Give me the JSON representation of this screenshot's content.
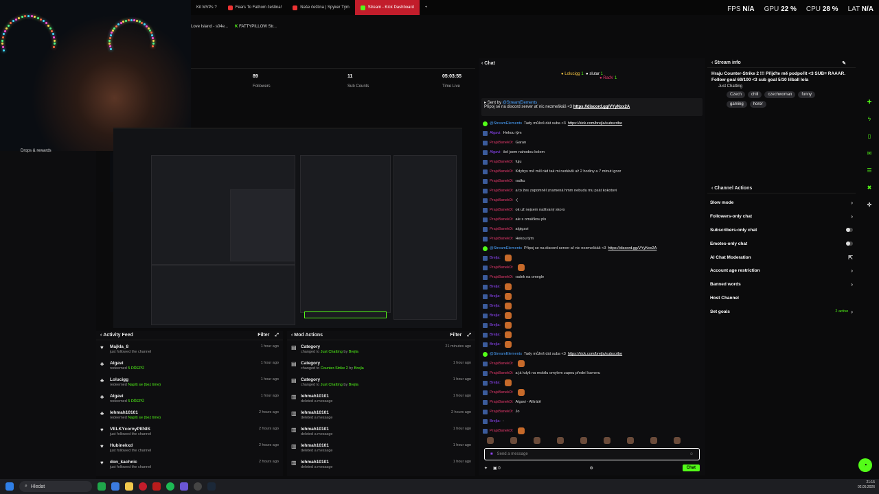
{
  "browser": {
    "tabs": [
      {
        "label": "Kit MVPs ?",
        "active": false
      },
      {
        "label": "Fears To Fathom čeština!",
        "active": false
      },
      {
        "label": "Naše čeština | Spyker Tým",
        "active": false
      },
      {
        "label": "Stream - Kick Dashboard",
        "active": true
      }
    ],
    "new_tab": "+",
    "bookmarks": [
      "Love Island - s04e...",
      "FATTYPILLOW Str..."
    ]
  },
  "perf": {
    "fps_label": "FPS",
    "fps": "N/A",
    "gpu_label": "GPU",
    "gpu": "22 %",
    "cpu_label": "CPU",
    "cpu": "28 %",
    "lat_label": "LAT",
    "lat": "N/A"
  },
  "left": {
    "drops": "Drops & rewards"
  },
  "stats": [
    {
      "value": "89",
      "label": "Followers"
    },
    {
      "value": "11",
      "label": "Sub Counts"
    },
    {
      "value": "05:03:55",
      "label": "Time Live"
    }
  ],
  "activity": {
    "title": "Activity Feed",
    "filter": "Filter",
    "items": [
      {
        "icon": "heart-icon",
        "user": "Majkla_8",
        "action": "just followed the channel",
        "highlight": "",
        "time": "1 hour ago"
      },
      {
        "icon": "reward-icon",
        "user": "Algavi",
        "action": "redeemed",
        "highlight": "5 DŘEPŮ",
        "time": "1 hour ago"
      },
      {
        "icon": "reward-icon",
        "user": "Lolucigg",
        "action": "redeemed",
        "highlight": "Napíš se (bez time)",
        "time": "1 hour ago"
      },
      {
        "icon": "reward-icon",
        "user": "Algavi",
        "action": "redeemed",
        "highlight": "5 DŘEPŮ",
        "time": "1 hour ago"
      },
      {
        "icon": "reward-icon",
        "user": "lehmah10101",
        "action": "redeemed",
        "highlight": "Napíš se (bez time)",
        "time": "2 hours ago"
      },
      {
        "icon": "heart-icon",
        "user": "VELKYcornyPENIS",
        "action": "just followed the channel",
        "highlight": "",
        "time": "2 hours ago"
      },
      {
        "icon": "heart-icon",
        "user": "Hubinekxd",
        "action": "just followed the channel",
        "highlight": "",
        "time": "2 hours ago"
      },
      {
        "icon": "heart-icon",
        "user": "don_kachnic",
        "action": "just followed the channel",
        "highlight": "",
        "time": "2 hours ago"
      }
    ]
  },
  "mod": {
    "title": "Mod Actions",
    "filter": "Filter",
    "items": [
      {
        "icon": "category-icon",
        "user": "Category",
        "action": "changed to",
        "highlight": "Just Chatting",
        "by": "by",
        "by_user": "Brejla",
        "time": "21 minutes ago"
      },
      {
        "icon": "category-icon",
        "user": "Category",
        "action": "changed to",
        "highlight": "Counter-Strike 2",
        "by": "by",
        "by_user": "Brejla",
        "time": "1 hour ago"
      },
      {
        "icon": "category-icon",
        "user": "Category",
        "action": "changed to",
        "highlight": "Just Chatting",
        "by": "by",
        "by_user": "Brejla",
        "time": "1 hour ago"
      },
      {
        "icon": "delete-icon",
        "user": "lehmah10101",
        "action": "deleted a message",
        "highlight": "",
        "by": "",
        "by_user": "",
        "time": "1 hour ago"
      },
      {
        "icon": "delete-icon",
        "user": "lehmah10101",
        "action": "deleted a message",
        "highlight": "",
        "by": "",
        "by_user": "",
        "time": "2 hours ago"
      },
      {
        "icon": "delete-icon",
        "user": "lehmah10101",
        "action": "deleted a message",
        "highlight": "",
        "by": "",
        "by_user": "",
        "time": "1 hour ago"
      },
      {
        "icon": "delete-icon",
        "user": "lehmah10101",
        "action": "deleted a message",
        "highlight": "",
        "by": "",
        "by_user": "",
        "time": "1 hour ago"
      },
      {
        "icon": "delete-icon",
        "user": "lehmah10101",
        "action": "deleted a message",
        "highlight": "",
        "by": "",
        "by_user": "",
        "time": "1 hour ago"
      }
    ]
  },
  "chat": {
    "title": "Chat",
    "viewers": [
      {
        "name": "Lolucigg",
        "n": "1"
      },
      {
        "name": "slutar",
        "n": "1"
      },
      {
        "name": "RadV",
        "n": "1"
      }
    ],
    "pinned": {
      "by": "Sent by",
      "author": "@StreamElements",
      "text": "Připoj se na discord server ať nic nezmeškáš <3",
      "link": "https://discord.gg/VYyNxx2A"
    },
    "messages": [
      {
        "user": "@StreamElements",
        "text": "Tady můžeš dát suba <3",
        "link": "https://kick.com/brejla/subscribe",
        "cls": "n3"
      },
      {
        "user": "Algavi:",
        "text": "Hekou tým",
        "link": "",
        "cls": "n2"
      },
      {
        "user": "PrajsBanek0l:",
        "text": "Garan",
        "link": "",
        "cls": "n"
      },
      {
        "user": "Algavi:",
        "text": "šel jsem nahodou kolem",
        "link": "",
        "cls": "n2"
      },
      {
        "user": "PrajsBanek0l:",
        "text": "fuju",
        "link": "",
        "cls": "n"
      },
      {
        "user": "PrajsBanek0l:",
        "text": "Kdybys mě měl rád tak mi nedávši už 2 hodiny a 7 minut ignor",
        "link": "",
        "cls": "n"
      },
      {
        "user": "PrajsBanek0l:",
        "text": "radku",
        "link": "",
        "cls": "n"
      },
      {
        "user": "PrajsBanek0l:",
        "text": "a to žes zapomněl znamená hmm nebudu mu psát kokotovi",
        "link": "",
        "cls": "n"
      },
      {
        "user": "PrajsBanek0l:",
        "text": ":(",
        "link": "",
        "cls": "n"
      },
      {
        "user": "PrajsBanek0l:",
        "text": "ok už nejsem naštvaný skoro",
        "link": "",
        "cls": "n"
      },
      {
        "user": "PrajsBanek0l:",
        "text": "ale s omáčkou pls",
        "link": "",
        "cls": "n"
      },
      {
        "user": "PrajsBanek0l:",
        "text": "algigavi",
        "link": "",
        "cls": "n"
      },
      {
        "user": "PrajsBanek0l:",
        "text": "Hekou tým",
        "link": "",
        "cls": "n"
      },
      {
        "user": "@StreamElements",
        "text": "Připoj se na discord server ať nic nezmeškáš <3",
        "link": "https://discord.gg/VYyNxx2A",
        "cls": "n3"
      },
      {
        "user": "Brejla:",
        "text": "",
        "link": "",
        "cls": "n2"
      },
      {
        "user": "PrajsBanek0l:",
        "text": "",
        "link": "",
        "cls": "n"
      },
      {
        "user": "PrajsBanek0l:",
        "text": "radek na omegle",
        "link": "",
        "cls": "n"
      },
      {
        "user": "Brejla:",
        "text": "",
        "link": "",
        "cls": "n2"
      },
      {
        "user": "Brejla:",
        "text": "",
        "link": "",
        "cls": "n2"
      },
      {
        "user": "Brejla:",
        "text": "",
        "link": "",
        "cls": "n2"
      },
      {
        "user": "Brejla:",
        "text": "",
        "link": "",
        "cls": "n2"
      },
      {
        "user": "Brejla:",
        "text": "",
        "link": "",
        "cls": "n2"
      },
      {
        "user": "Brejla:",
        "text": "",
        "link": "",
        "cls": "n2"
      },
      {
        "user": "Brejla:",
        "text": "",
        "link": "",
        "cls": "n2"
      },
      {
        "user": "@StreamElements",
        "text": "Tady můžeš dát suba <3",
        "link": "https://kick.com/brejla/subscribe",
        "cls": "n3"
      },
      {
        "user": "PrajsBanek0l:",
        "text": "",
        "link": "",
        "cls": "n"
      },
      {
        "user": "PrajsBanek0l:",
        "text": "a já když na mobilu omylem zapnu přední kameru",
        "link": "",
        "cls": "n"
      },
      {
        "user": "Brejla:",
        "text": "",
        "link": "",
        "cls": "n2"
      },
      {
        "user": "PrajsBanek0l:",
        "text": "",
        "link": "",
        "cls": "n"
      },
      {
        "user": "PrajsBanek0l:",
        "text": "Algavi - Alltrátě",
        "link": "",
        "cls": "n"
      },
      {
        "user": "PrajsBanek0l:",
        "text": "Jo",
        "link": "",
        "cls": "n"
      },
      {
        "user": "Brejla:",
        "text": "-",
        "link": "",
        "cls": "n2"
      },
      {
        "user": "PrajsBanek0l:",
        "text": "",
        "link": "",
        "cls": "n"
      }
    ],
    "placeholder": "Send a message",
    "counter": "0",
    "chat_button": "Chat"
  },
  "stream_info": {
    "title": "Stream info",
    "text": "Hraju Counter-Strike 2 !!! Přijďte mě podpořit <3 SUB= RAAAR. Follow goal 69/100 <3 sub goal 5/10 lilball lola",
    "category": "Just Chatting",
    "tags": [
      "Czech",
      "chill",
      "czechwoman",
      "funny",
      "gaming",
      "horor"
    ]
  },
  "channel_actions": {
    "title": "Channel Actions",
    "items": [
      {
        "label": "Slow mode",
        "control": "chevron"
      },
      {
        "label": "Followers-only chat",
        "control": "chevron"
      },
      {
        "label": "Subscribers-only chat",
        "control": "toggle"
      },
      {
        "label": "Emotes-only chat",
        "control": "toggle"
      },
      {
        "label": "AI Chat Moderation",
        "control": "external"
      },
      {
        "label": "Account age restriction",
        "control": "chevron"
      },
      {
        "label": "Banned words",
        "control": "chevron"
      },
      {
        "label": "Host Channel",
        "control": ""
      },
      {
        "label": "Set goals",
        "control": "chevron",
        "badge": "2 active"
      }
    ]
  },
  "taskbar": {
    "search": "Hledat",
    "time": "21:15",
    "date": "02.05.2026"
  },
  "colors": {
    "accent": "#53fc18",
    "tab_active": "#c21d2b"
  }
}
